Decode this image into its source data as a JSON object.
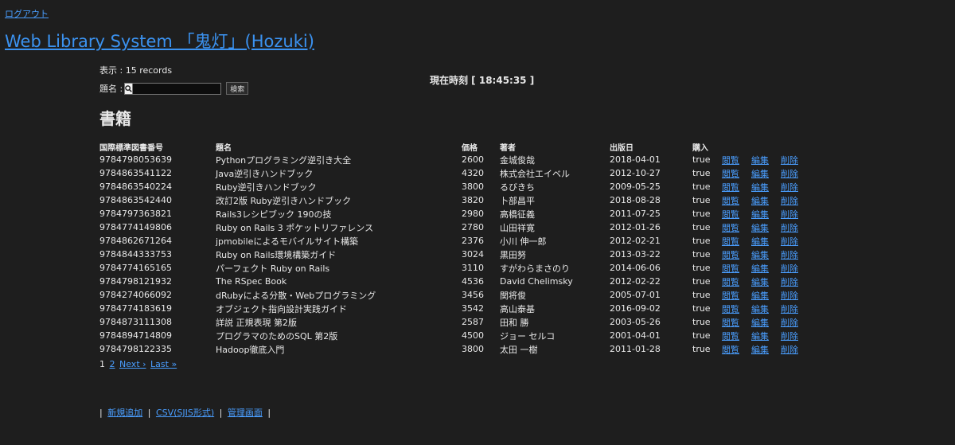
{
  "header": {
    "logout_label": "ログアウト",
    "site_title": "Web Library System 「鬼灯」(Hozuki)"
  },
  "summary": {
    "records_text": "表示 : 15 records",
    "clock_text": "現在時刻 [ 18:45:35 ]"
  },
  "search": {
    "label": "題名 :",
    "value": "",
    "button_label": "検索",
    "icon": "search-icon"
  },
  "section_title": "書籍",
  "table": {
    "headers": [
      "国際標準図書番号",
      "題名",
      "価格",
      "著者",
      "出版日",
      "購入"
    ],
    "action_labels": {
      "view": "閲覧",
      "edit": "編集",
      "delete": "削除"
    },
    "rows": [
      [
        "9784798053639",
        "Pythonプログラミング逆引き大全",
        "2600",
        "金城俊哉",
        "2018-04-01",
        "true"
      ],
      [
        "9784863541122",
        "Java逆引きハンドブック",
        "4320",
        "株式会社エイベル",
        "2012-10-27",
        "true"
      ],
      [
        "9784863540224",
        "Ruby逆引きハンドブック",
        "3800",
        "るびきち",
        "2009-05-25",
        "true"
      ],
      [
        "9784863542440",
        "改訂2版 Ruby逆引きハンドブック",
        "3820",
        "卜部昌平",
        "2018-08-28",
        "true"
      ],
      [
        "9784797363821",
        "Rails3レシピブック 190の技",
        "2980",
        "高橋征義",
        "2011-07-25",
        "true"
      ],
      [
        "9784774149806",
        "Ruby on Rails 3 ポケットリファレンス",
        "2780",
        "山田祥寛",
        "2012-01-26",
        "true"
      ],
      [
        "9784862671264",
        "jpmobileによるモバイルサイト構築",
        "2376",
        "小川 伸一郎",
        "2012-02-21",
        "true"
      ],
      [
        "9784844333753",
        "Ruby on Rails環境構築ガイド",
        "3024",
        "黒田努",
        "2013-03-22",
        "true"
      ],
      [
        "9784774165165",
        "パーフェクト Ruby on Rails",
        "3110",
        "すがわらまさのり",
        "2014-06-06",
        "true"
      ],
      [
        "9784798121932",
        "The RSpec Book",
        "4536",
        "David Chelimsky",
        "2012-02-22",
        "true"
      ],
      [
        "9784274066092",
        "dRubyによる分散・Webプログラミング",
        "3456",
        "関将俊",
        "2005-07-01",
        "true"
      ],
      [
        "9784774183619",
        "オブジェクト指向設計実践ガイド",
        "3542",
        "高山泰基",
        "2016-09-02",
        "true"
      ],
      [
        "9784873111308",
        "詳説 正規表現 第2版",
        "2587",
        "田和 勝",
        "2003-05-26",
        "true"
      ],
      [
        "9784894714809",
        "プログラマのためのSQL 第2版",
        "4500",
        "ジョー セルコ",
        "2001-04-01",
        "true"
      ],
      [
        "9784798122335",
        "Hadoop徹底入門",
        "3800",
        "太田 一樹",
        "2011-01-28",
        "true"
      ]
    ]
  },
  "pagination": {
    "current": "1",
    "page2": "2",
    "next": "Next ›",
    "last": "Last »"
  },
  "footer": {
    "separator": "|",
    "new_label": "新規追加",
    "csv_label": "CSV(SJIS形式)",
    "admin_label": "管理画面"
  }
}
